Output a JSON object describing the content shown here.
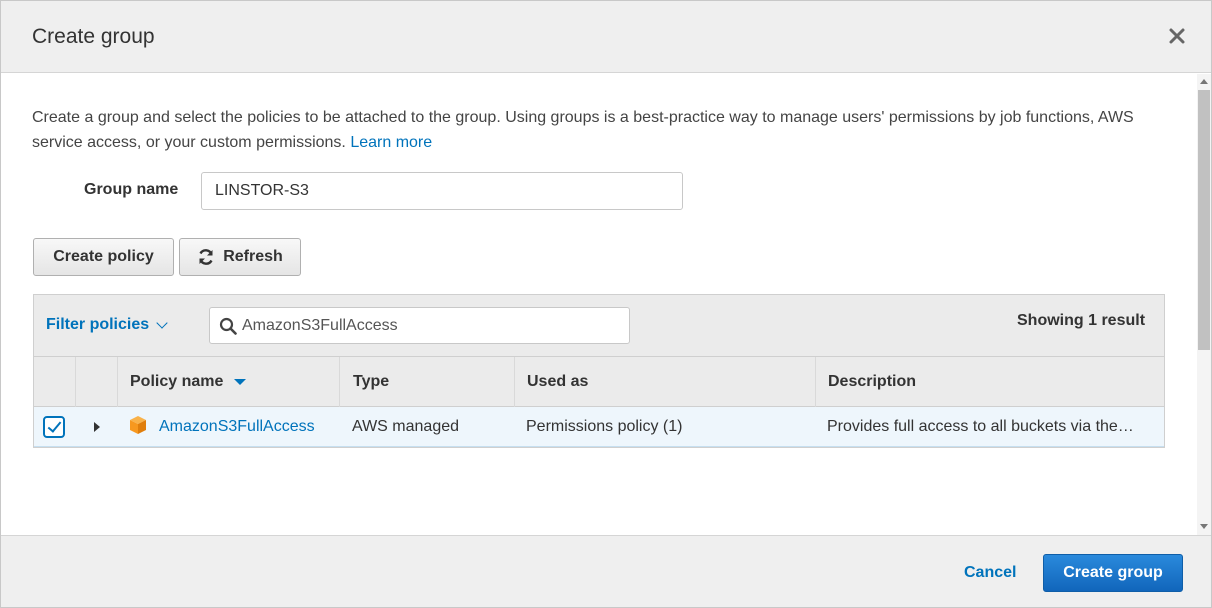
{
  "dialog": {
    "title": "Create group",
    "close_icon": "close-icon"
  },
  "intro": {
    "text": "Create a group and select the policies to be attached to the group. Using groups is a best-practice way to manage users' permissions by job functions, AWS service access, or your custom permissions. ",
    "learn_more": "Learn more"
  },
  "group_name": {
    "label": "Group name",
    "value": "LINSTOR-S3"
  },
  "toolbar": {
    "create_policy_label": "Create policy",
    "refresh_label": "Refresh",
    "refresh_icon": "refresh-icon"
  },
  "filter": {
    "label": "Filter policies",
    "search_value": "AmazonS3FullAccess",
    "search_icon": "search-icon",
    "showing": "Showing 1 result"
  },
  "table": {
    "columns": [
      "Policy name",
      "Type",
      "Used as",
      "Description"
    ],
    "sorted_column": "Policy name",
    "rows": [
      {
        "checked": true,
        "policy_name": "AmazonS3FullAccess",
        "type": "AWS managed",
        "used_as": "Permissions policy (1)",
        "description": "Provides full access to all buckets via the…"
      }
    ]
  },
  "footer": {
    "cancel_label": "Cancel",
    "create_label": "Create group"
  },
  "colors": {
    "link": "#0073bb",
    "primary_button": "#1a74c9",
    "policy_icon": "#f7981f",
    "selected_row": "#eef6fc"
  }
}
